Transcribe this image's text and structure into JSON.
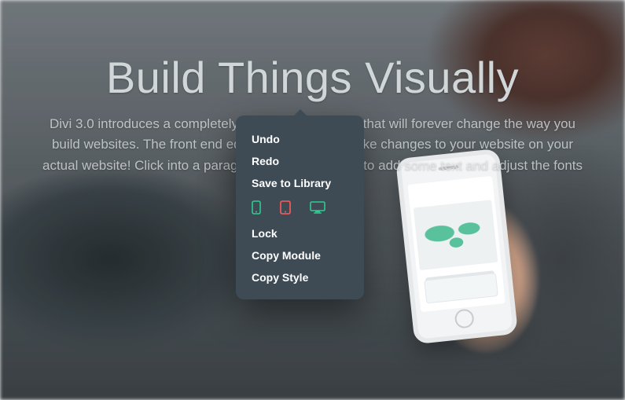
{
  "hero": {
    "title": "Build Things Visually",
    "body": "Divi 3.0 introduces a completely new visual interface that will forever change the way you build websites. The front end editor allows you to make changes to your website on your actual website! Click into a paragraph and start typing to add some text and adjust the fonts"
  },
  "contextMenu": {
    "undo": "Undo",
    "redo": "Redo",
    "save": "Save to Library",
    "lock": "Lock",
    "copyMod": "Copy Module",
    "copySty": "Copy Style",
    "devices": {
      "phone": {
        "name": "phone-icon",
        "color": "#2ecc8f"
      },
      "tablet": {
        "name": "tablet-icon",
        "color": "#ff5b5b"
      },
      "desktop": {
        "name": "desktop-icon",
        "color": "#2ecc8f"
      }
    }
  },
  "colors": {
    "menuBg": "#3e4b55",
    "accentTeal": "#1fa894"
  }
}
